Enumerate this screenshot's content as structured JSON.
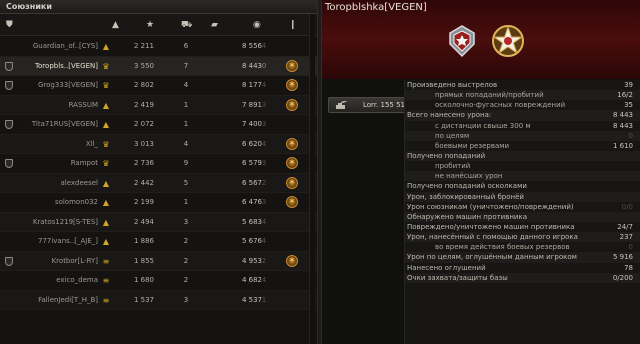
{
  "allies": {
    "title": "Союзники",
    "column_icons": [
      "clan-shield-icon",
      "rank-icon",
      "experience-star-icon",
      "kills-tank-icon",
      "damage-shell-icon",
      "spotted-icon",
      "medals-icon"
    ],
    "rows": [
      {
        "name": "Guardian_of..[CYS]",
        "clan": false,
        "rank": "▲",
        "xp": "2 211",
        "kills": "6",
        "damage": "8 556",
        "spotted": "4",
        "medal": false
      },
      {
        "name": "Toropbls..[VEGEN]",
        "clan": true,
        "rank": "♛",
        "xp": "3 550",
        "kills": "7",
        "damage": "8 443",
        "spotted": "0",
        "medal": true
      },
      {
        "name": "Grog333[VEGEN]",
        "clan": true,
        "rank": "♛",
        "xp": "2 802",
        "kills": "4",
        "damage": "8 177",
        "spotted": "4",
        "medal": true
      },
      {
        "name": "RASSUM",
        "clan": false,
        "rank": "▲",
        "xp": "2 419",
        "kills": "1",
        "damage": "7 891",
        "spotted": "3",
        "medal": true
      },
      {
        "name": "Tita71RUS[VEGEN]",
        "clan": true,
        "rank": "▲",
        "xp": "2 072",
        "kills": "1",
        "damage": "7 400",
        "spotted": "3",
        "medal": false
      },
      {
        "name": "Xll_",
        "clan": false,
        "rank": "♛",
        "xp": "3 013",
        "kills": "4",
        "damage": "6 620",
        "spotted": "4",
        "medal": true
      },
      {
        "name": "Rampot",
        "clan": true,
        "rank": "♛",
        "xp": "2 736",
        "kills": "9",
        "damage": "6 579",
        "spotted": "3",
        "medal": true
      },
      {
        "name": "alexdeesel",
        "clan": false,
        "rank": "▲",
        "xp": "2 442",
        "kills": "5",
        "damage": "6 567",
        "spotted": "2",
        "medal": true
      },
      {
        "name": "solomon032",
        "clan": false,
        "rank": "▲",
        "xp": "2 199",
        "kills": "1",
        "damage": "6 476",
        "spotted": "3",
        "medal": true
      },
      {
        "name": "Kratos1219[S-TES]",
        "clan": false,
        "rank": "▲",
        "xp": "2 494",
        "kills": "3",
        "damage": "5 683",
        "spotted": "4",
        "medal": false
      },
      {
        "name": "777ivans..[_AJE_]",
        "clan": false,
        "rank": "▲",
        "xp": "1 886",
        "kills": "2",
        "damage": "5 676",
        "spotted": "4",
        "medal": false
      },
      {
        "name": "Krotbor[L-RY]",
        "clan": true,
        "rank": "≡",
        "xp": "1 855",
        "kills": "2",
        "damage": "4 953",
        "spotted": "2",
        "medal": true
      },
      {
        "name": "exico_dema",
        "clan": false,
        "rank": "≡",
        "xp": "1 680",
        "kills": "2",
        "damage": "4 682",
        "spotted": "4",
        "medal": false
      },
      {
        "name": "FallenJedi[T_H_B]",
        "clan": false,
        "rank": "≡",
        "xp": "1 537",
        "kills": "3",
        "damage": "4 537",
        "spotted": "1",
        "medal": false
      }
    ]
  },
  "player": {
    "name": "Toropblshka[VEGEN]",
    "badges": [
      "shield-badge-icon",
      "star-badge-icon"
    ],
    "vehicle": "Lorr. 155 51"
  },
  "stats": [
    {
      "label": "Произведено выстрелов",
      "value": "39",
      "sub": false
    },
    {
      "label": "прямых попаданий/пробитий",
      "value": "16/2",
      "sub": true
    },
    {
      "label": "осколочно-фугасных повреждений",
      "value": "35",
      "sub": true
    },
    {
      "label": "Всего нанесено урона:",
      "value": "8 443",
      "sub": false
    },
    {
      "label": "с дистанции свыше 300 м",
      "value": "8 443",
      "sub": true
    },
    {
      "label": "по целям",
      "value": "0",
      "sub": true,
      "dim": true
    },
    {
      "label": "боевыми резервами",
      "value": "1 610",
      "sub": true
    },
    {
      "label": "Получено попаданий",
      "value": "",
      "sub": false
    },
    {
      "label": "пробитий",
      "value": "",
      "sub": true
    },
    {
      "label": "не нанёсших урон",
      "value": "",
      "sub": true
    },
    {
      "label": "Получено попаданий осколками",
      "value": "",
      "sub": false
    },
    {
      "label": "Урон, заблокированный бронёй",
      "value": "",
      "sub": false
    },
    {
      "label": "Урон союзникам (уничтожено/повреждений)",
      "value": "0/0",
      "sub": false,
      "dim": true
    },
    {
      "label": "Обнаружено машин противника",
      "value": "",
      "sub": false
    },
    {
      "label": "Повреждено/уничтожено машин противника",
      "value": "24/7",
      "sub": false
    },
    {
      "label": "Урон, нанесённый с помощью данного игрока",
      "value": "237",
      "sub": false
    },
    {
      "label": "во время действия боевых резервов",
      "value": "0",
      "sub": true,
      "dim": true
    },
    {
      "label": "Урон по целям, оглушённым данным игроком",
      "value": "5 916",
      "sub": false
    },
    {
      "label": "Нанесено оглушений",
      "value": "78",
      "sub": false
    },
    {
      "label": "Очки захвата/защиты базы",
      "value": "0/200",
      "sub": false
    }
  ]
}
